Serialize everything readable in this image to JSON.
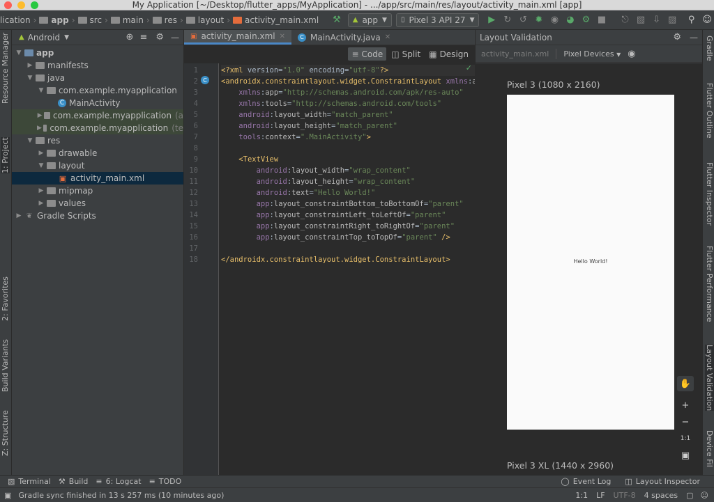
{
  "window": {
    "title": "My Application [~/Desktop/flutter_apps/MyApplication] - .../app/src/main/res/layout/activity_main.xml [app]"
  },
  "breadcrumb": [
    "lication",
    "app",
    "src",
    "main",
    "res",
    "layout",
    "activity_main.xml"
  ],
  "toolbar": {
    "run_config": "app",
    "device": "Pixel 3 API 27"
  },
  "left_tools": [
    "Resource Manager",
    "1: Project",
    "2: Favorites",
    "Build Variants",
    "Z: Structure"
  ],
  "right_tools": [
    "Gradle",
    "Flutter Outline",
    "Flutter Inspector",
    "Flutter Performance",
    "Layout Validation",
    "Device Fil"
  ],
  "project": {
    "view_mode": "Android",
    "tree": [
      {
        "label": "app",
        "note": "",
        "level": 0,
        "expanded": true,
        "icon": "module-folder-icon"
      },
      {
        "label": "manifests",
        "note": "",
        "level": 1,
        "expanded": false,
        "icon": "folder-icon"
      },
      {
        "label": "java",
        "note": "",
        "level": 1,
        "expanded": true,
        "icon": "folder-icon"
      },
      {
        "label": "com.example.myapplication",
        "note": "",
        "level": 2,
        "expanded": true,
        "icon": "folder-icon"
      },
      {
        "label": "MainActivity",
        "note": "",
        "level": 3,
        "leaf": true,
        "icon": "class-icon"
      },
      {
        "label": "com.example.myapplication",
        "note": "(a",
        "level": 2,
        "expanded": false,
        "icon": "folder-icon"
      },
      {
        "label": "com.example.myapplication",
        "note": "(te",
        "level": 2,
        "expanded": false,
        "icon": "folder-icon"
      },
      {
        "label": "res",
        "note": "",
        "level": 1,
        "expanded": true,
        "icon": "folder-icon"
      },
      {
        "label": "drawable",
        "note": "",
        "level": 2,
        "expanded": false,
        "icon": "folder-icon"
      },
      {
        "label": "layout",
        "note": "",
        "level": 2,
        "expanded": true,
        "icon": "folder-icon"
      },
      {
        "label": "activity_main.xml",
        "note": "",
        "level": 3,
        "leaf": true,
        "icon": "xml-file-icon"
      },
      {
        "label": "mipmap",
        "note": "",
        "level": 2,
        "expanded": false,
        "icon": "folder-icon"
      },
      {
        "label": "values",
        "note": "",
        "level": 2,
        "expanded": false,
        "icon": "folder-icon"
      },
      {
        "label": "Gradle Scripts",
        "note": "",
        "level": 0,
        "expanded": false,
        "icon": "gradle-icon"
      }
    ]
  },
  "editor": {
    "tabs": [
      {
        "label": "activity_main.xml",
        "active": true
      },
      {
        "label": "MainActivity.java",
        "active": false
      }
    ],
    "modes": [
      "Code",
      "Split",
      "Design"
    ],
    "code_lines": [
      "<?xml version=\"1.0\" encoding=\"utf-8\"?>",
      "<androidx.constraintlayout.widget.ConstraintLayout xmlns:an",
      "    xmlns:app=\"http://schemas.android.com/apk/res-auto\"",
      "    xmlns:tools=\"http://schemas.android.com/tools\"",
      "    android:layout_width=\"match_parent\"",
      "    android:layout_height=\"match_parent\"",
      "    tools:context=\".MainActivity\">",
      "",
      "    <TextView",
      "        android:layout_width=\"wrap_content\"",
      "        android:layout_height=\"wrap_content\"",
      "        android:text=\"Hello World!\"",
      "        app:layout_constraintBottom_toBottomOf=\"parent\"",
      "        app:layout_constraintLeft_toLeftOf=\"parent\"",
      "        app:layout_constraintRight_toRightOf=\"parent\"",
      "        app:layout_constraintTop_toTopOf=\"parent\" />",
      "",
      "</androidx.constraintlayout.widget.ConstraintLayout>"
    ]
  },
  "validation": {
    "title": "Layout Validation",
    "file": "activity_main.xml",
    "device_filter": "Pixel Devices",
    "device1": "Pixel 3 (1080 x 2160)",
    "device2": "Pixel 3 XL (1440 x 2960)",
    "preview_text": "Hello World!",
    "zoom_ratio": "1:1"
  },
  "bottom_tools": {
    "terminal": "Terminal",
    "build": "Build",
    "logcat": "6: Logcat",
    "todo": "TODO",
    "event_log": "Event Log",
    "layout_inspector": "Layout Inspector"
  },
  "status": {
    "message": "Gradle sync finished in 13 s 257 ms (10 minutes ago)",
    "position": "1:1",
    "line_sep": "LF",
    "encoding": "UTF-8",
    "indent": "4 spaces"
  },
  "colors": {
    "accent": "#4a88c7",
    "run": "#59a869",
    "selection": "#0d293e"
  }
}
